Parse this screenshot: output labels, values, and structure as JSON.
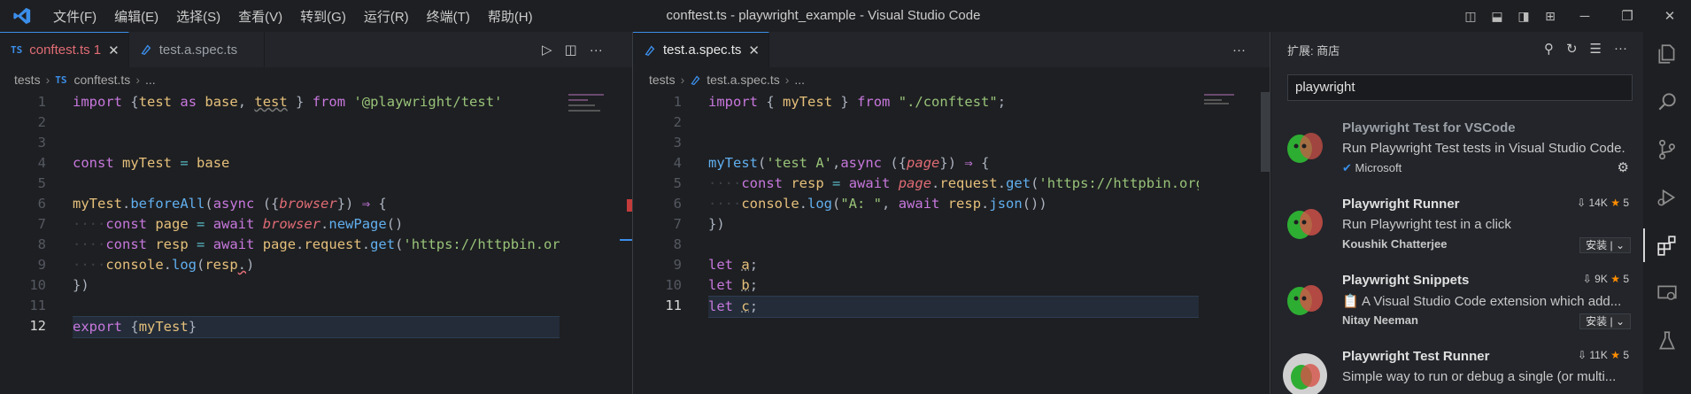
{
  "window": {
    "title": "conftest.ts - playwright_example - Visual Studio Code"
  },
  "menu": [
    "文件(F)",
    "编辑(E)",
    "选择(S)",
    "查看(V)",
    "转到(G)",
    "运行(R)",
    "终端(T)",
    "帮助(H)"
  ],
  "left_editor": {
    "tabs": [
      {
        "badge": "TS",
        "label": "conftest.ts 1",
        "close": "✕"
      },
      {
        "label": "test.a.spec.ts"
      }
    ],
    "breadcrumb": [
      "tests",
      "TS",
      "conftest.ts",
      "..."
    ],
    "line_numbers": [
      "1",
      "2",
      "3",
      "4",
      "5",
      "6",
      "7",
      "8",
      "9",
      "10",
      "11",
      "12"
    ]
  },
  "right_editor": {
    "tabs": [
      {
        "label": "test.a.spec.ts",
        "close": "✕"
      }
    ],
    "breadcrumb": [
      "tests",
      "test.a.spec.ts",
      "..."
    ],
    "line_numbers": [
      "1",
      "2",
      "3",
      "4",
      "5",
      "6",
      "7",
      "8",
      "9",
      "10",
      "11"
    ]
  },
  "extensions": {
    "header": "扩展: 商店",
    "search_value": "playwright",
    "items": [
      {
        "name": "Playwright Test for VSCode",
        "desc": "Run Playwright Test tests in Visual Studio Code.",
        "publisher": "Microsoft",
        "verified": true
      },
      {
        "name": "Playwright Runner",
        "desc": "Run Playwright test in a click",
        "publisher": "Koushik Chatterjee",
        "downloads": "14K",
        "rating": "5",
        "install": "安装"
      },
      {
        "name": "Playwright Snippets",
        "desc": "📋 A Visual Studio Code extension which add...",
        "publisher": "Nitay Neeman",
        "downloads": "9K",
        "rating": "5",
        "install": "安装"
      },
      {
        "name": "Playwright Test Runner",
        "desc": "Simple way to run or debug a single (or multi...",
        "downloads": "11K",
        "rating": "5"
      }
    ]
  },
  "colors": {
    "accent": "#3b8eea",
    "keyword": "#c778dd",
    "string": "#98c379",
    "function": "#61afef",
    "star": "#ff8e00"
  }
}
